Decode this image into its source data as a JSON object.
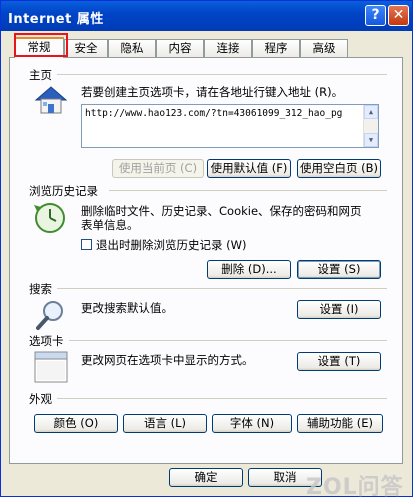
{
  "window": {
    "title": "Internet 属性",
    "help": "?",
    "close": "✕"
  },
  "tabs": [
    "常规",
    "安全",
    "隐私",
    "内容",
    "连接",
    "程序",
    "高级"
  ],
  "home": {
    "label": "主页",
    "description": "若要创建主页选项卡，请在各地址行键入地址 (R)。",
    "url": "http://www.hao123.com/?tn=43061099_312_hao_pg",
    "use_current": "使用当前页 (C)",
    "use_default": "使用默认值 (F)",
    "use_blank": "使用空白页 (B)"
  },
  "history": {
    "label": "浏览历史记录",
    "description_line1": "删除临时文件、历史记录、Cookie、保存的密码和网页",
    "description_line2": "表单信息。",
    "checkbox_label": "退出时删除浏览历史记录 (W)",
    "checkbox_checked": false,
    "delete_button": "删除 (D)...",
    "settings_button": "设置 (S)"
  },
  "search": {
    "label": "搜索",
    "description": "更改搜索默认值。",
    "settings_button": "设置 (I)"
  },
  "tabs_section": {
    "label": "选项卡",
    "description": "更改网页在选项卡中显示的方式。",
    "settings_button": "设置 (T)"
  },
  "appearance": {
    "label": "外观",
    "colors": "颜色 (O)",
    "languages": "语言 (L)",
    "fonts": "字体 (N)",
    "accessibility": "辅助功能 (E)"
  },
  "footer": {
    "ok": "确定",
    "cancel": "取消"
  },
  "watermark": "ZOL问答",
  "colors": {
    "titlebar": "#0a5fdd",
    "highlight": "#e8141c",
    "window_bg": "#ece9d8"
  }
}
